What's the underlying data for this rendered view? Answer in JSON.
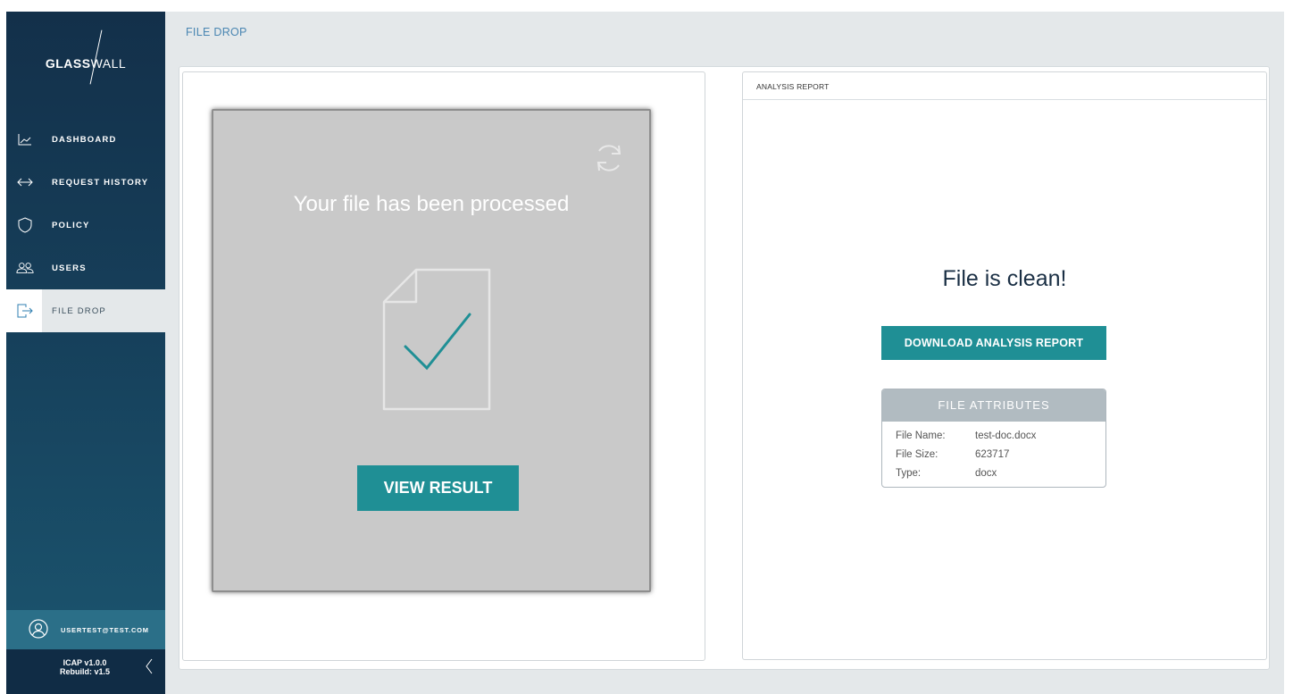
{
  "brand": {
    "name_bold": "GLASS",
    "name_light": "WALL"
  },
  "sidebar": {
    "items": [
      {
        "label": "DASHBOARD",
        "icon": "chart-line-icon"
      },
      {
        "label": "REQUEST HISTORY",
        "icon": "arrows-horizontal-icon"
      },
      {
        "label": "POLICY",
        "icon": "shield-icon"
      },
      {
        "label": "USERS",
        "icon": "users-icon"
      },
      {
        "label": "FILE DROP",
        "icon": "file-drop-icon",
        "active": true
      }
    ],
    "user": {
      "email": "USERTEST@TEST.COM",
      "icon": "user-circle-icon"
    },
    "version": {
      "line1": "ICAP v1.0.0",
      "line2": "Rebuild: v1.5"
    }
  },
  "header": {
    "title": "FILE DROP"
  },
  "file_drop": {
    "message": "Your file has been processed",
    "view_result_label": "VIEW RESULT"
  },
  "report": {
    "section_title": "ANALYSIS REPORT",
    "status": "File is clean!",
    "download_label": "DOWNLOAD ANALYSIS REPORT",
    "attributes_title": "FILE ATTRIBUTES",
    "attributes": [
      {
        "key": "File Name:",
        "value": "test-doc.docx"
      },
      {
        "key": "File Size:",
        "value": "623717"
      },
      {
        "key": "Type:",
        "value": "docx"
      }
    ]
  },
  "colors": {
    "sidebar_top": "#13304a",
    "sidebar_bottom": "#1b5670",
    "accent": "#1f8f95",
    "header_bg": "#e4e8ea",
    "title_blue": "#4a86b2"
  }
}
